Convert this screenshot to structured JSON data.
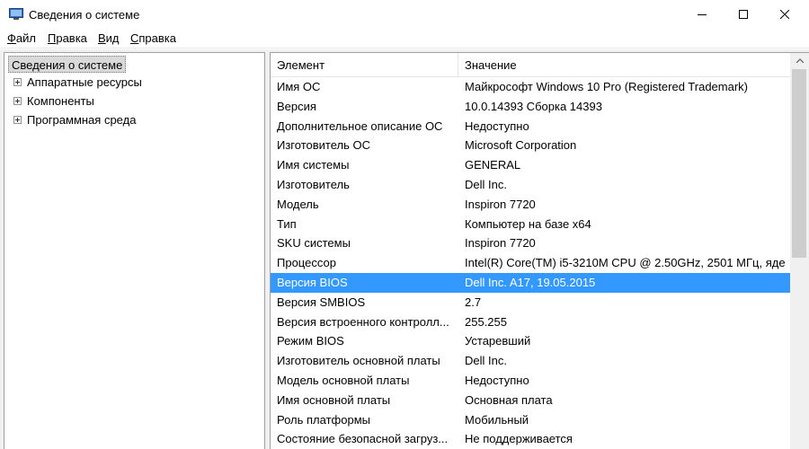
{
  "window": {
    "title": "Сведения о системе",
    "icons": {
      "app": "system-info-icon",
      "minimize": "minimize-icon",
      "maximize": "maximize-icon",
      "close": "close-icon"
    }
  },
  "menu": {
    "items": [
      {
        "accel": "Ф",
        "rest": "айл"
      },
      {
        "accel": "П",
        "rest": "равка"
      },
      {
        "accel": "В",
        "rest": "ид"
      },
      {
        "accel": "С",
        "rest": "правка"
      }
    ]
  },
  "tree": {
    "root": "Сведения о системе",
    "nodes": [
      "Аппаратные ресурсы",
      "Компоненты",
      "Программная среда"
    ]
  },
  "table": {
    "headers": {
      "item": "Элемент",
      "value": "Значение"
    },
    "selected_index": 10,
    "rows": [
      {
        "item": "Имя ОС",
        "value": "Майкрософт Windows 10 Pro (Registered Trademark)"
      },
      {
        "item": "Версия",
        "value": "10.0.14393 Сборка 14393"
      },
      {
        "item": "Дополнительное описание ОС",
        "value": "Недоступно"
      },
      {
        "item": "Изготовитель ОС",
        "value": "Microsoft Corporation"
      },
      {
        "item": "Имя системы",
        "value": "GENERAL"
      },
      {
        "item": "Изготовитель",
        "value": "Dell Inc."
      },
      {
        "item": "Модель",
        "value": "Inspiron 7720"
      },
      {
        "item": "Тип",
        "value": "Компьютер на базе x64"
      },
      {
        "item": "SKU системы",
        "value": "Inspiron 7720"
      },
      {
        "item": "Процессор",
        "value": "Intel(R) Core(TM) i5-3210M CPU @ 2.50GHz, 2501 МГц, яде"
      },
      {
        "item": "Версия BIOS",
        "value": "Dell Inc. A17, 19.05.2015"
      },
      {
        "item": "Версия SMBIOS",
        "value": "2.7"
      },
      {
        "item": "Версия встроенного контролл...",
        "value": "255.255"
      },
      {
        "item": "Режим BIOS",
        "value": "Устаревший"
      },
      {
        "item": "Изготовитель основной платы",
        "value": "Dell Inc."
      },
      {
        "item": "Модель основной платы",
        "value": "Недоступно"
      },
      {
        "item": "Имя основной платы",
        "value": "Основная плата"
      },
      {
        "item": "Роль платформы",
        "value": "Мобильный"
      },
      {
        "item": "Состояние безопасной загруз...",
        "value": "Не поддерживается"
      }
    ]
  },
  "colors": {
    "selection": "#3399ff",
    "selection_text": "#ffffff",
    "tree_selected": "#d9d9d9"
  }
}
